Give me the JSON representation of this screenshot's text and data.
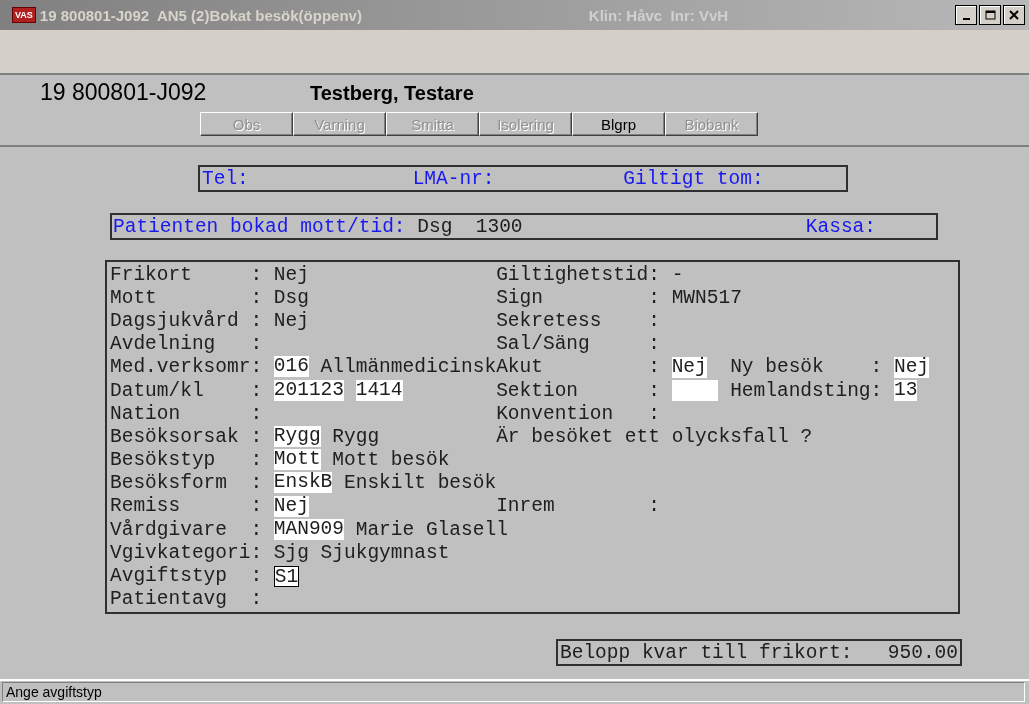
{
  "window": {
    "badge": "VAS",
    "title": "19 800801-J092  AN5 (2)Bokat besök(öppenv)",
    "context": "Klin: Håvc  Inr: VvH"
  },
  "patient": {
    "id": "19 800801-J092",
    "name": "Testberg, Testare"
  },
  "flag_buttons": [
    {
      "label": "Obs",
      "disabled": true
    },
    {
      "label": "Varning",
      "disabled": true
    },
    {
      "label": "Smitta",
      "disabled": true
    },
    {
      "label": "Isolering",
      "disabled": true
    },
    {
      "label": "Blgrp",
      "disabled": false
    },
    {
      "label": "Biobank",
      "disabled": true
    }
  ],
  "contact_box": [
    {
      "label": "Tel:"
    },
    {
      "label": "LMA-nr:"
    },
    {
      "label": "Giltigt tom:"
    }
  ],
  "booking_box": {
    "label": "Patienten bokad mott/tid:",
    "value": "Dsg  1300",
    "cash_label": "Kassa:"
  },
  "form": {
    "rows": [
      {
        "left": {
          "label": "Frikort",
          "sep": ":",
          "values": [
            {
              "kind": "text",
              "text": "Nej"
            }
          ]
        },
        "right": {
          "label": "Giltighetstid",
          "sep": ":",
          "values": [
            {
              "kind": "text",
              "text": "-"
            }
          ]
        }
      },
      {
        "left": {
          "label": "Mott",
          "sep": ":",
          "values": [
            {
              "kind": "text",
              "text": "Dsg"
            }
          ]
        },
        "right": {
          "label": "Sign",
          "sep": ":",
          "values": [
            {
              "kind": "text",
              "text": "MWN517"
            }
          ]
        }
      },
      {
        "left": {
          "label": "Dagsjukvård",
          "sep": ":",
          "values": [
            {
              "kind": "text",
              "text": "Nej"
            }
          ]
        },
        "right": {
          "label": "Sekretess",
          "sep": ":"
        }
      },
      {
        "left": {
          "label": "Avdelning",
          "sep": ":"
        },
        "right": {
          "label": "Sal/Säng",
          "sep": ":"
        }
      },
      {
        "left": {
          "label": "Med.verksomr",
          "sep": ":",
          "values": [
            {
              "kind": "field",
              "text": "016",
              "focused": false
            },
            {
              "kind": "text",
              "text": "Allmänmedicinsk"
            }
          ]
        },
        "right": {
          "label": "Akut",
          "sep": ":",
          "values": [
            {
              "kind": "field",
              "text": "Nej",
              "focused": false
            }
          ]
        },
        "extra": {
          "label": "Ny besök",
          "sep": ":",
          "values": [
            {
              "kind": "field",
              "text": "Nej",
              "focused": false
            }
          ]
        }
      },
      {
        "left": {
          "label": "Datum/kl",
          "sep": ":",
          "values": [
            {
              "kind": "field",
              "text": "201123",
              "focused": false
            },
            {
              "kind": "field",
              "text": "1414",
              "focused": false
            }
          ]
        },
        "right": {
          "label": "Sektion",
          "sep": ":",
          "values": [
            {
              "kind": "field",
              "focused": false
            }
          ]
        },
        "extra": {
          "label": "Hemlandsting",
          "sep": ":",
          "values": [
            {
              "kind": "field",
              "text": "13",
              "focused": false
            }
          ]
        }
      },
      {
        "left": {
          "label": "Nation",
          "sep": ":"
        },
        "right": {
          "label": "Konvention",
          "sep": ":"
        }
      },
      {
        "left": {
          "label": "Besöksorsak",
          "sep": ":",
          "values": [
            {
              "kind": "field",
              "text": "Rygg",
              "focused": false
            },
            {
              "kind": "text",
              "text": "Rygg"
            }
          ]
        },
        "right": {
          "label": "Är besöket ett olycksfall ?"
        }
      },
      {
        "left": {
          "label": "Besökstyp",
          "sep": ":",
          "values": [
            {
              "kind": "field",
              "text": "Mott",
              "focused": false
            },
            {
              "kind": "text",
              "text": "Mott besök"
            }
          ]
        }
      },
      {
        "left": {
          "label": "Besöksform",
          "sep": ":",
          "values": [
            {
              "kind": "field",
              "text": "EnskB",
              "focused": false
            },
            {
              "kind": "text",
              "text": "Enskilt besök"
            }
          ]
        }
      },
      {
        "left": {
          "label": "Remiss",
          "sep": ":",
          "values": [
            {
              "kind": "field",
              "text": "Nej",
              "focused": false
            }
          ]
        },
        "right": {
          "label": "Inrem",
          "sep": ":"
        }
      },
      {
        "left": {
          "label": "Vårdgivare",
          "sep": ":",
          "values": [
            {
              "kind": "field",
              "text": "MAN909",
              "focused": false
            },
            {
              "kind": "text",
              "text": "Marie Glasell"
            }
          ]
        }
      },
      {
        "left": {
          "label": "Vgivkategori",
          "sep": ":",
          "values": [
            {
              "kind": "text",
              "text": "Sjg"
            },
            {
              "kind": "text",
              "text": "Sjukgymnast"
            }
          ]
        }
      },
      {
        "left": {
          "label": "Avgiftstyp",
          "sep": ":",
          "values": [
            {
              "kind": "field",
              "text": "S1",
              "focused": true
            }
          ]
        }
      },
      {
        "left": {
          "label": "Patientavg",
          "sep": ":"
        }
      }
    ]
  },
  "remaining": {
    "label": "Belopp kvar till frikort:",
    "value": "950.00"
  },
  "status_bar": "Ange avgiftstyp"
}
